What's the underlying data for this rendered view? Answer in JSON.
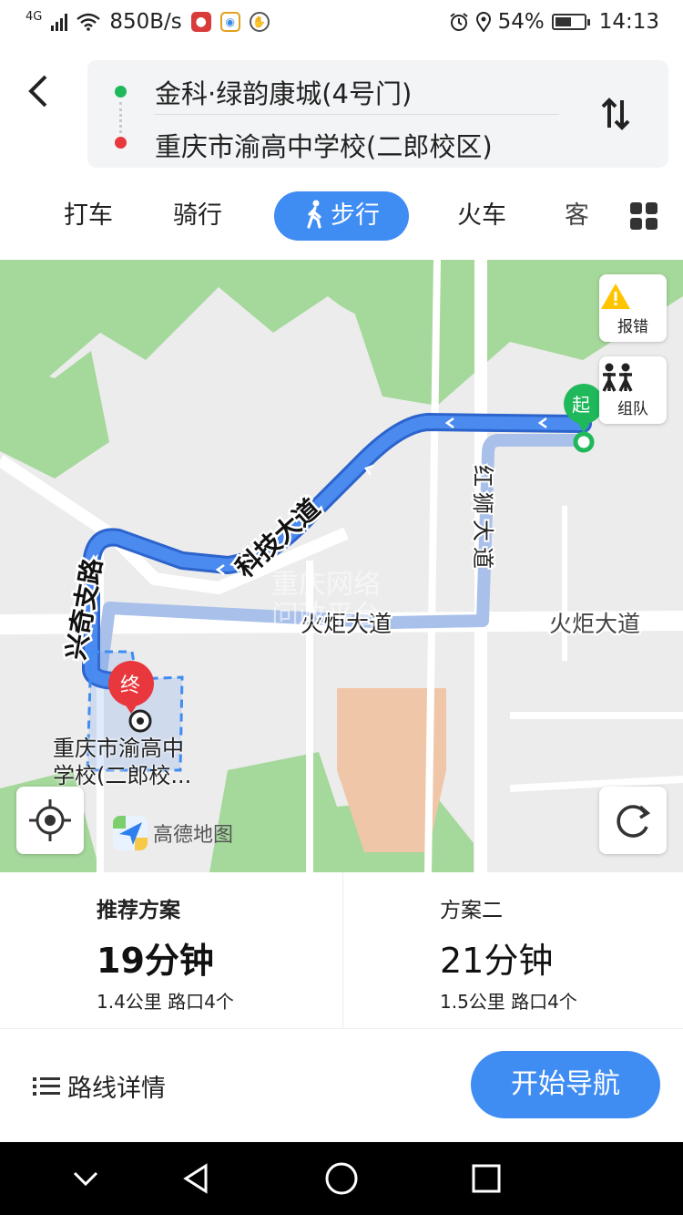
{
  "status_bar": {
    "network": "4G",
    "speed": "850B/s",
    "battery": "54%",
    "time": "14:13"
  },
  "route": {
    "origin": "金科·绿韵康城(4号门)",
    "destination": "重庆市渝高中学校(二郎校区)"
  },
  "modes": [
    {
      "label": "打车"
    },
    {
      "label": "骑行"
    },
    {
      "label": "步行",
      "active": true
    },
    {
      "label": "火车"
    },
    {
      "label": "客"
    }
  ],
  "map": {
    "report_label": "报错",
    "team_label": "组队",
    "start_marker": "起",
    "end_marker": "终",
    "poi_label_line1": "重庆市渝高中",
    "poi_label_line2": "学校(二郎校...",
    "brand": "高德地图",
    "watermark_line1": "重庆网络",
    "watermark_line2": "问政平台",
    "roads": {
      "keji": "科技大道",
      "xingzhi": "兴奇支路",
      "hongshi": "红狮大道",
      "huoju": "火炬大道",
      "huoju2": "火炬大道"
    }
  },
  "plans": [
    {
      "title": "推荐方案",
      "time": "19分钟",
      "meta": "1.4公里 路口4个"
    },
    {
      "title": "方案二",
      "time": "21分钟",
      "meta": "1.5公里 路口4个"
    }
  ],
  "bottom": {
    "detail_label": "路线详情",
    "start_nav_label": "开始导航"
  },
  "colors": {
    "accent": "#3f8cf2",
    "route_main": "#3d7be8",
    "route_alt": "#a9c0ea",
    "start_green": "#1fb85b",
    "end_red": "#e8383d",
    "park_green": "#a5d89b"
  }
}
